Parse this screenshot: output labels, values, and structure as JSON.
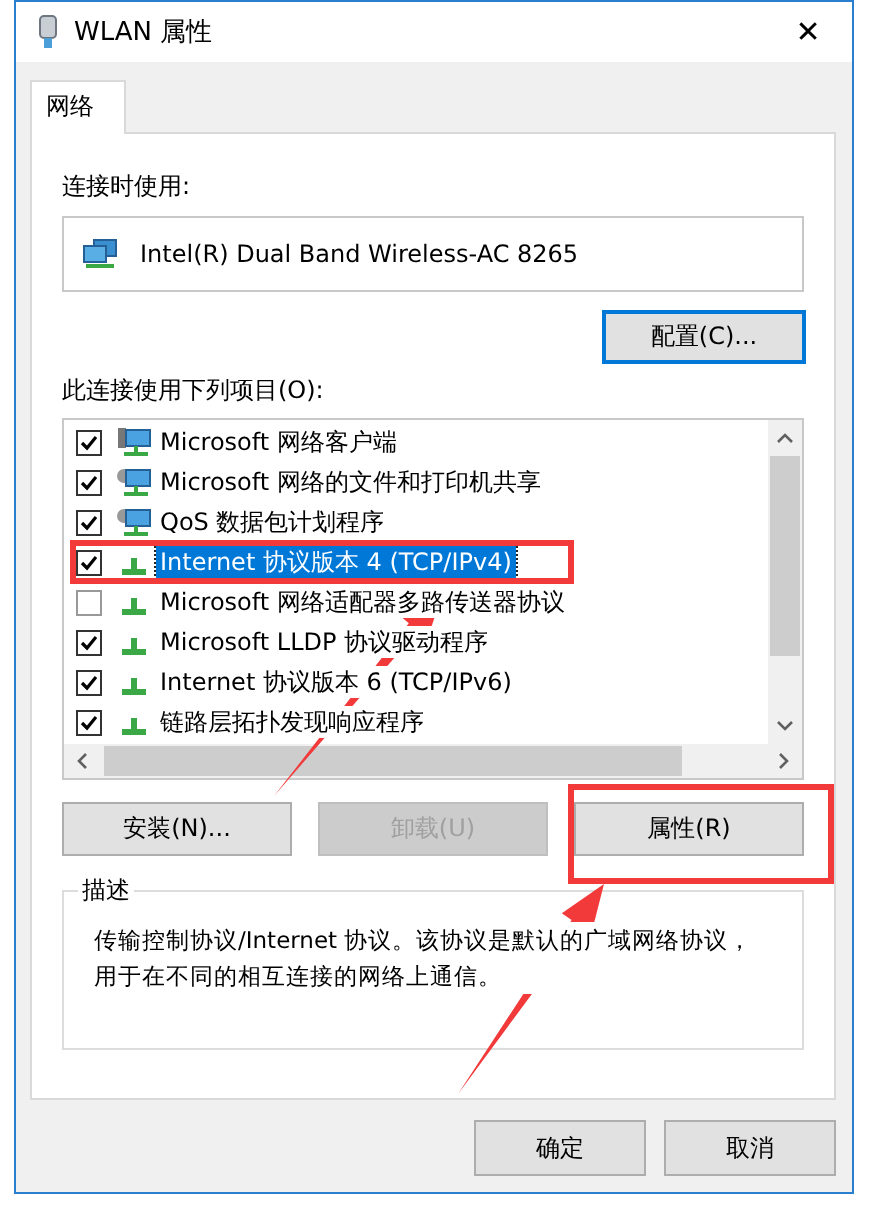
{
  "window": {
    "title": "WLAN 属性",
    "close": "✕"
  },
  "tabs": [
    {
      "label": "网络",
      "selected": true
    }
  ],
  "connect_using": {
    "label": "连接时使用:",
    "adapter": "Intel(R) Dual Band Wireless-AC 8265"
  },
  "configure_button": {
    "label": "配置(C)...",
    "focused": true
  },
  "items_label": "此连接使用下列项目(O):",
  "items": [
    {
      "kind": "client",
      "label": "Microsoft 网络客户端",
      "checked": true,
      "selected": false
    },
    {
      "kind": "service",
      "label": "Microsoft 网络的文件和打印机共享",
      "checked": true,
      "selected": false
    },
    {
      "kind": "service",
      "label": "QoS 数据包计划程序",
      "checked": true,
      "selected": false
    },
    {
      "kind": "protocol",
      "label": "Internet 协议版本 4 (TCP/IPv4)",
      "checked": true,
      "selected": true
    },
    {
      "kind": "protocol",
      "label": "Microsoft 网络适配器多路传送器协议",
      "checked": false,
      "selected": false
    },
    {
      "kind": "protocol",
      "label": "Microsoft LLDP 协议驱动程序",
      "checked": true,
      "selected": false
    },
    {
      "kind": "protocol",
      "label": "Internet 协议版本 6 (TCP/IPv6)",
      "checked": true,
      "selected": false
    },
    {
      "kind": "protocol",
      "label": "链路层拓扑发现响应程序",
      "checked": true,
      "selected": false
    }
  ],
  "item_buttons": [
    {
      "label": "安装(N)...",
      "disabled": false
    },
    {
      "label": "卸载(U)",
      "disabled": true
    },
    {
      "label": "属性(R)",
      "disabled": false
    }
  ],
  "description": {
    "legend": "描述",
    "text": "传输控制协议/Internet 协议。该协议是默认的广域网络协议，用于在不同的相互连接的网络上通信。"
  },
  "dialog_buttons": [
    {
      "label": "确定"
    },
    {
      "label": "取消"
    }
  ]
}
